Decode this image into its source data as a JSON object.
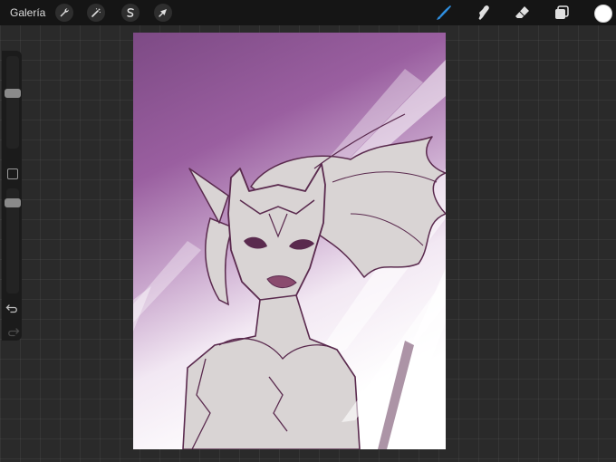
{
  "app": {
    "gallery_label": "Galería"
  },
  "toolbar": {
    "left_tools": [
      {
        "name": "actions",
        "icon": "wrench-icon"
      },
      {
        "name": "adjustments",
        "icon": "magic-wand-icon"
      },
      {
        "name": "selection",
        "icon": "selection-s-icon"
      },
      {
        "name": "transform",
        "icon": "arrow-cursor-icon"
      }
    ],
    "right_tools": [
      {
        "name": "brush",
        "icon": "brush-icon",
        "active": true
      },
      {
        "name": "smudge",
        "icon": "smudge-finger-icon"
      },
      {
        "name": "eraser",
        "icon": "eraser-icon"
      },
      {
        "name": "layers",
        "icon": "layers-icon"
      }
    ],
    "active_color": "#ffffff",
    "active_tool_color": "#2f8fe0"
  },
  "sidebar": {
    "brush_size_icon": "brush-size-slider",
    "opacity_icon": "opacity-slider",
    "modify_icon": "square-modify-icon",
    "undo_icon": "undo-icon",
    "redo_icon": "redo-icon"
  },
  "canvas": {
    "background_top": "#7d4a85",
    "background_bottom": "#ffffff",
    "line_color": "#5a2a4e",
    "fill_color": "#d9d4d4"
  }
}
